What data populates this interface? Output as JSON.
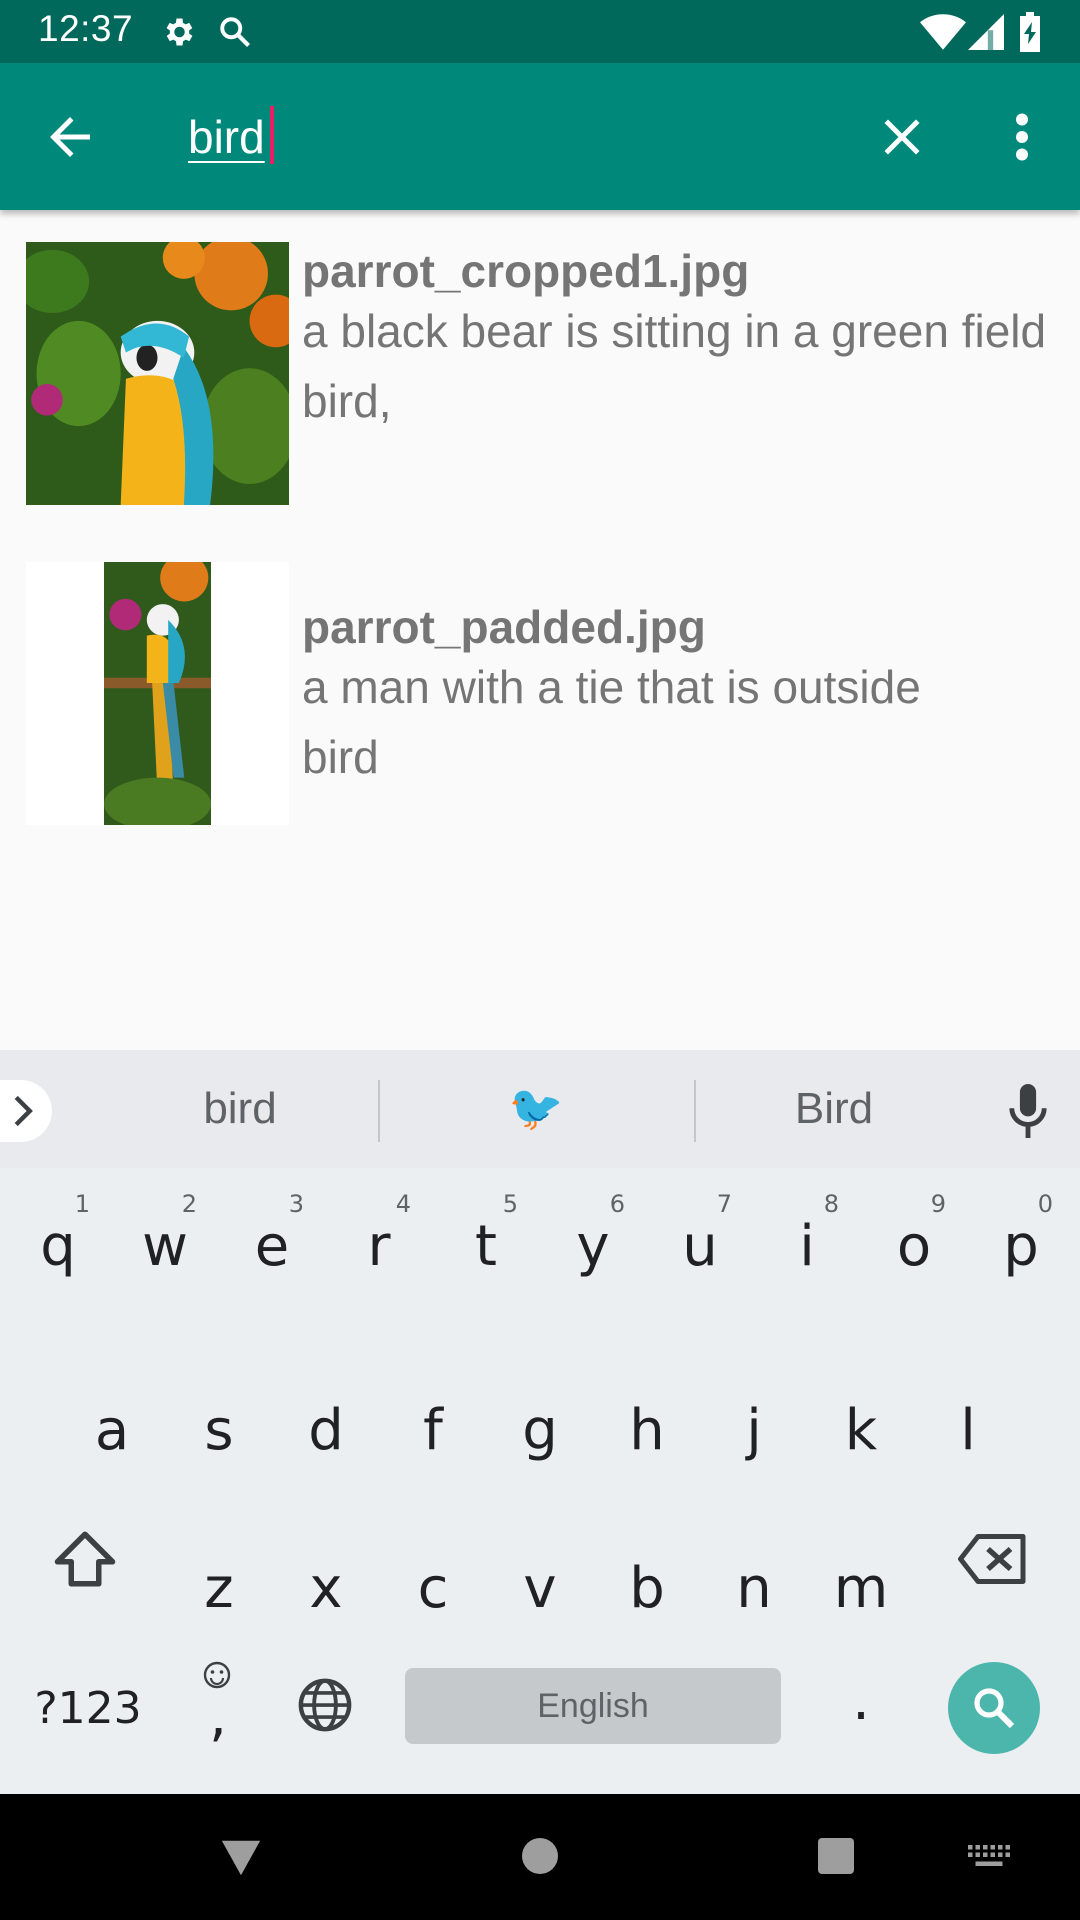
{
  "status_bar": {
    "time": "12:37",
    "icons": [
      "gear-icon",
      "search-icon",
      "wifi-icon",
      "signal-icon",
      "battery-charging-icon"
    ]
  },
  "app_bar": {
    "search_value": "bird",
    "back_icon": "arrow-back-icon",
    "clear_icon": "close-icon",
    "overflow_icon": "more-vert-icon"
  },
  "results": [
    {
      "filename": "parrot_cropped1.jpg",
      "description": "a black bear is sitting in a green field",
      "tags": "bird,"
    },
    {
      "filename": "parrot_padded.jpg",
      "description": "a man with a tie that is outside",
      "tags": "bird"
    }
  ],
  "keyboard": {
    "suggestions": [
      "bird",
      "🐦",
      "Bird"
    ],
    "row1": [
      {
        "key": "q",
        "hint": "1"
      },
      {
        "key": "w",
        "hint": "2"
      },
      {
        "key": "e",
        "hint": "3"
      },
      {
        "key": "r",
        "hint": "4"
      },
      {
        "key": "t",
        "hint": "5"
      },
      {
        "key": "y",
        "hint": "6"
      },
      {
        "key": "u",
        "hint": "7"
      },
      {
        "key": "i",
        "hint": "8"
      },
      {
        "key": "o",
        "hint": "9"
      },
      {
        "key": "p",
        "hint": "0"
      }
    ],
    "row2": [
      "a",
      "s",
      "d",
      "f",
      "g",
      "h",
      "j",
      "k",
      "l"
    ],
    "row3": [
      "z",
      "x",
      "c",
      "v",
      "b",
      "n",
      "m"
    ],
    "symbols_key": "?123",
    "comma_key": ",",
    "period_key": ".",
    "space_label": "English"
  },
  "colors": {
    "status_bar": "#00695c",
    "app_bar": "#00897b",
    "cursor": "#e91e63",
    "search_key": "#4db6ac"
  }
}
